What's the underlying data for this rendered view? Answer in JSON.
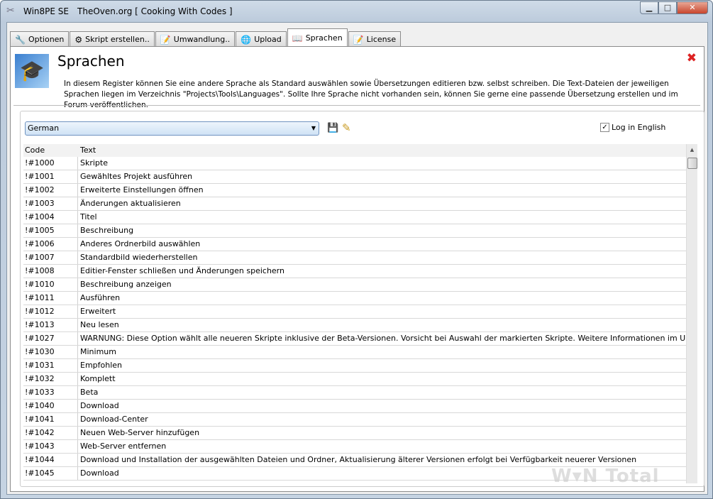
{
  "window": {
    "app": "Win8PE SE",
    "title": "TheOven.org [ Cooking With Codes ]"
  },
  "tabs": [
    {
      "label": "Optionen",
      "icon": "wrench-icon"
    },
    {
      "label": "Skript erstellen..",
      "icon": "gear-icon"
    },
    {
      "label": "Umwandlung..",
      "icon": "notepad-icon"
    },
    {
      "label": "Upload",
      "icon": "globe-icon"
    },
    {
      "label": "Sprachen",
      "icon": "book-icon"
    },
    {
      "label": "License",
      "icon": "notepad-icon"
    }
  ],
  "header": {
    "title": "Sprachen",
    "description": "In diesem Register können Sie eine andere Sprache als Standard auswählen sowie Übersetzungen editieren bzw. selbst schreiben. Die Text-Dateien der jeweiligen Sprachen liegen im Verzeichnis \"Projects\\Tools\\Languages\". Sollte Ihre Sprache nicht vorhanden sein, können Sie gerne eine passende Übersetzung erstellen und im Forum veröffentlichen."
  },
  "language": {
    "selected": "German"
  },
  "log_english": {
    "label": "Log in English",
    "checked": true
  },
  "table": {
    "columns": [
      "Code",
      "Text"
    ],
    "rows": [
      [
        "!#1000",
        "Skripte"
      ],
      [
        "!#1001",
        "Gewähltes Projekt ausführen"
      ],
      [
        "!#1002",
        "Erweiterte Einstellungen öffnen"
      ],
      [
        "!#1003",
        "Änderungen aktualisieren"
      ],
      [
        "!#1004",
        "Titel"
      ],
      [
        "!#1005",
        "Beschreibung"
      ],
      [
        "!#1006",
        "Anderes Ordnerbild auswählen"
      ],
      [
        "!#1007",
        "Standardbild wiederherstellen"
      ],
      [
        "!#1008",
        "Editier-Fenster schließen und Änderungen speichern"
      ],
      [
        "!#1010",
        "Beschreibung anzeigen"
      ],
      [
        "!#1011",
        "Ausführen"
      ],
      [
        "!#1012",
        "Erweitert"
      ],
      [
        "!#1013",
        "Neu lesen"
      ],
      [
        "!#1027",
        "WARNUNG: Diese Option wählt alle neueren Skripte inklusive der Beta-Versionen. Vorsicht bei Auswahl der markierten Skripte. Weitere Informationen im Unterforum 'Tutorials' auf"
      ],
      [
        "!#1030",
        "Minimum"
      ],
      [
        "!#1031",
        "Empfohlen"
      ],
      [
        "!#1032",
        "Komplett"
      ],
      [
        "!#1033",
        "Beta"
      ],
      [
        "!#1040",
        "Download"
      ],
      [
        "!#1041",
        "Download-Center"
      ],
      [
        "!#1042",
        "Neuen Web-Server hinzufügen"
      ],
      [
        "!#1043",
        "Web-Server entfernen"
      ],
      [
        "!#1044",
        "Download und Installation der ausgewählten Dateien und Ordner, Aktualisierung älterer Versionen erfolgt bei Verfügbarkeit neuerer Versionen"
      ],
      [
        "!#1045",
        "Download"
      ]
    ]
  },
  "watermark": "WinTotal"
}
